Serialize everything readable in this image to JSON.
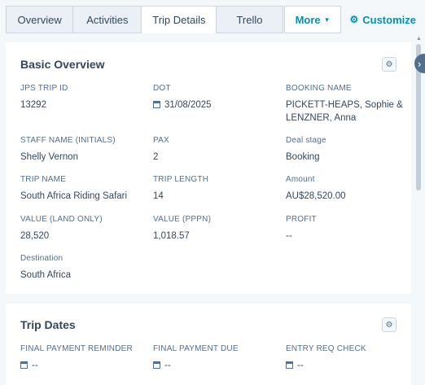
{
  "tabs": [
    {
      "label": "Overview"
    },
    {
      "label": "Activities"
    },
    {
      "label": "Trip Details"
    },
    {
      "label": "Trello"
    }
  ],
  "more_label": "More",
  "customize_label": "Customize",
  "basic_overview": {
    "title": "Basic Overview",
    "fields": {
      "jps_trip_id": {
        "label": "JPS TRIP ID",
        "value": "13292"
      },
      "dot": {
        "label": "DOT",
        "value": "31/08/2025"
      },
      "booking_name": {
        "label": "BOOKING NAME",
        "value_line1": "PICKETT-HEAPS, Sophie &",
        "value_line2": "LENZNER, Anna"
      },
      "staff_name": {
        "label": "STAFF NAME (INITIALS)",
        "value": "Shelly Vernon"
      },
      "pax": {
        "label": "PAX",
        "value": "2"
      },
      "deal_stage": {
        "label": "Deal stage",
        "value": "Booking"
      },
      "trip_name": {
        "label": "TRIP NAME",
        "value": "South Africa Riding Safari"
      },
      "trip_length": {
        "label": "TRIP LENGTH",
        "value": "14"
      },
      "amount": {
        "label": "Amount",
        "value": "AU$28,520.00"
      },
      "value_land_only": {
        "label": "VALUE (LAND ONLY)",
        "value": "28,520"
      },
      "value_pppn": {
        "label": "VALUE (PPPN)",
        "value": "1,018.57"
      },
      "profit": {
        "label": "PROFIT",
        "value": "--"
      },
      "destination": {
        "label": "Destination",
        "value": "South Africa"
      }
    }
  },
  "trip_dates": {
    "title": "Trip Dates",
    "fields": {
      "final_payment_reminder": {
        "label": "FINAL PAYMENT REMINDER",
        "value": "--"
      },
      "final_payment_due": {
        "label": "FINAL PAYMENT DUE",
        "value": "--"
      },
      "entry_req_check": {
        "label": "ENTRY REQ CHECK",
        "value": "--"
      }
    }
  },
  "icons": {
    "gear": "gear-icon",
    "calendar": "calendar-icon",
    "chevron": "chevron-down-icon",
    "collapse": "chevron-right-icon"
  }
}
